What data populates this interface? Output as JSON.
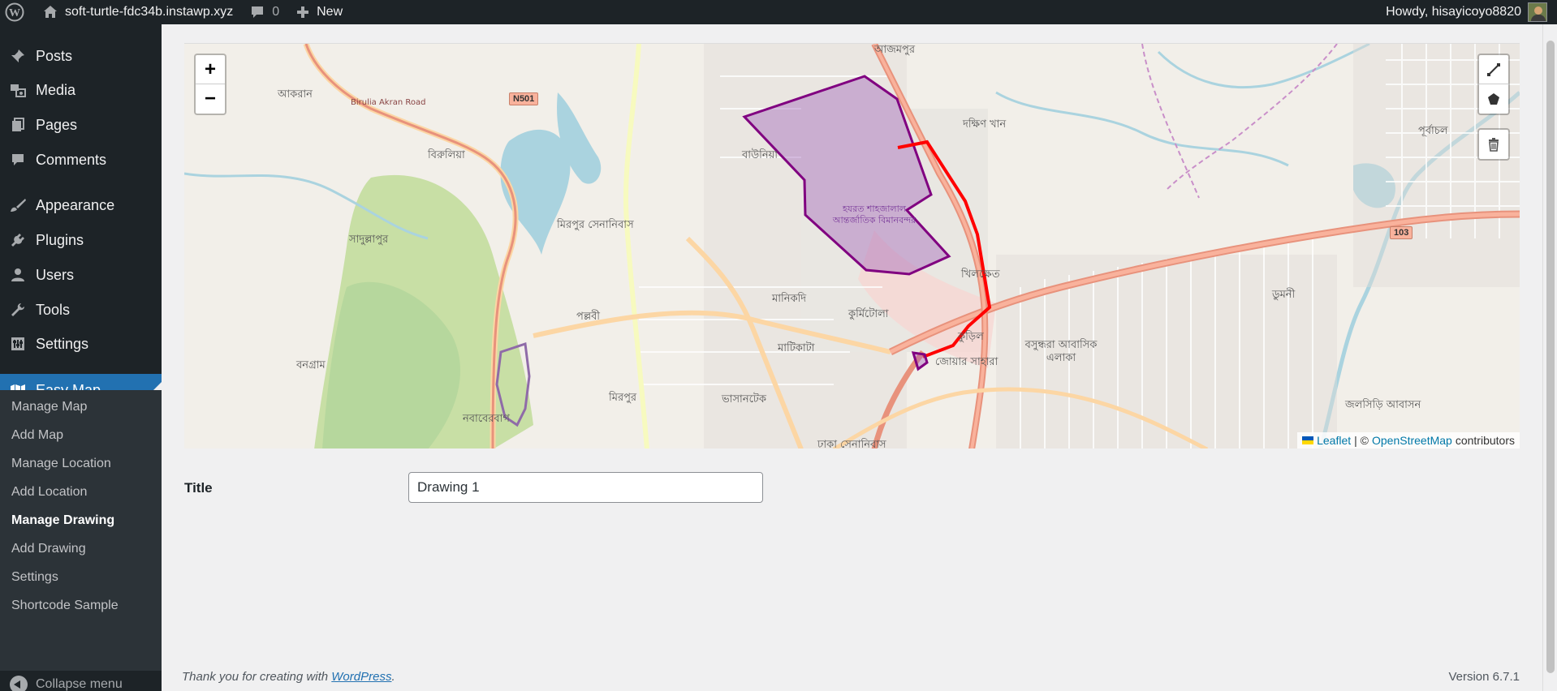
{
  "adminbar": {
    "site_name": "soft-turtle-fdc34b.instawp.xyz",
    "comments_count": "0",
    "new_label": "New",
    "howdy": "Howdy, hisayicoyo8820"
  },
  "sidebar": {
    "items": [
      {
        "label": "Posts",
        "icon": "pushpin-icon"
      },
      {
        "label": "Media",
        "icon": "media-icon"
      },
      {
        "label": "Pages",
        "icon": "pages-icon"
      },
      {
        "label": "Comments",
        "icon": "comment-icon"
      },
      {
        "label": "Appearance",
        "icon": "paintbrush-icon"
      },
      {
        "label": "Plugins",
        "icon": "plug-icon"
      },
      {
        "label": "Users",
        "icon": "user-icon"
      },
      {
        "label": "Tools",
        "icon": "wrench-icon"
      },
      {
        "label": "Settings",
        "icon": "sliders-icon"
      },
      {
        "label": "Easy Map",
        "icon": "map-icon"
      }
    ],
    "submenu": [
      "Manage Map",
      "Add Map",
      "Manage Location",
      "Add Location",
      "Manage Drawing",
      "Add Drawing",
      "Settings",
      "Shortcode Sample"
    ],
    "current_submenu": "Manage Drawing",
    "collapse_label": "Collapse menu"
  },
  "map": {
    "zoom_in": "+",
    "zoom_out": "−",
    "attribution": {
      "leaflet": "Leaflet",
      "separator": "| ©",
      "osm": "OpenStreetMap",
      "suffix": "contributors"
    },
    "labels": {
      "akaran": "আকরান",
      "birulia_road": "Birulia Akran Road",
      "n501": "N501",
      "birulia": "বিরুলিয়া",
      "saddupur": "সাদুল্লাপুর",
      "mirpur_cantonment": "মিরপুর সেনানিবাস",
      "pallabi": "পল্লবী",
      "mirpur": "মিরপুর",
      "nababerbagh": "নবাবেরবাগ",
      "bangram": "বনগ্রাম",
      "bauniya": "বাউনিয়া",
      "manikdi": "মানিকদি",
      "kurmitola": "কুর্মিটোলা",
      "matikata": "মাটিকাটা",
      "bhasantek": "ভাসানটেক",
      "dhaka_cantonment": "ঢাকা সেনানিবাস",
      "joar_sahara": "জোয়ার সাহারা",
      "kuril": "কুড়িল",
      "khilkhet": "খিলক্ষেত",
      "bashundhara": "বসুন্ধরা আবাসিক এলাকা",
      "dakshin_khan": "দক্ষিণ খান",
      "purbachal": "পূর্বাচল",
      "dumni": "ডুমনী",
      "jolshiri": "জলসিড়ি আবাসন",
      "ajampur": "আজমপুর",
      "airport": "হযরত শাহজালাল আন্তর্জাতিক বিমানবন্দর",
      "r103": "103"
    }
  },
  "form": {
    "title_label": "Title",
    "title_value": "Drawing 1"
  },
  "footer": {
    "thanks_prefix": "Thank you for creating with",
    "wordpress_link": "WordPress",
    "thanks_suffix": ".",
    "version": "Version 6.7.1"
  },
  "colors": {
    "admin_bg": "#1d2327",
    "accent": "#2271b1",
    "polyline": "#ff0000",
    "polygon_stroke": "#800080",
    "polygon_fill": "#9b59b6"
  }
}
